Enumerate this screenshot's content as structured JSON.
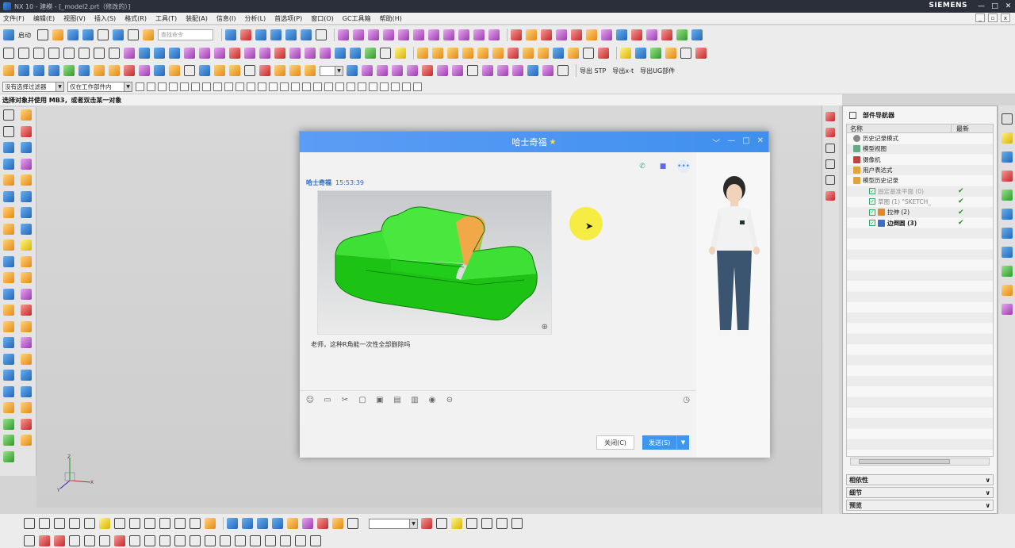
{
  "window": {
    "title": "NX 10 - 建模 - [_model2.prt（修改的）]",
    "brand": "SIEMENS",
    "controls": [
      "—",
      "□",
      "✕"
    ]
  },
  "menu": {
    "items": [
      "文件(F)",
      "编辑(E)",
      "视图(V)",
      "插入(S)",
      "格式(R)",
      "工具(T)",
      "装配(A)",
      "信息(I)",
      "分析(L)",
      "首选项(P)",
      "窗口(O)",
      "GC工具箱",
      "帮助(H)"
    ]
  },
  "toolbar": {
    "start_label": "启动",
    "search_placeholder": "查找命令",
    "export_stp": "导出 STP",
    "export_xt": "导出x-t",
    "export_ug": "导出UG部件"
  },
  "selection": {
    "filter_value": "没有选择过滤器",
    "scope_value": "仅在工作部件内"
  },
  "status_prompt": "选择对象并使用 MB3，或者双击某一对象",
  "navigator": {
    "title": "部件导航器",
    "col_name": "名称",
    "col_latest": "最新",
    "nodes": [
      {
        "label": "历史记录模式",
        "level": 0,
        "checked": false,
        "latest": false
      },
      {
        "label": "模型视图",
        "level": 0,
        "checked": false,
        "latest": false
      },
      {
        "label": "摄像机",
        "level": 0,
        "checked": false,
        "latest": false
      },
      {
        "label": "用户表达式",
        "level": 0,
        "checked": false,
        "latest": false
      },
      {
        "label": "模型历史记录",
        "level": 0,
        "checked": false,
        "latest": false
      },
      {
        "label": "固定基准平面 (0)",
        "level": 1,
        "checked": true,
        "latest": true
      },
      {
        "label": "草图 (1) \"SKETCH_",
        "level": 1,
        "checked": true,
        "latest": true
      },
      {
        "label": "拉伸 (2)",
        "level": 1,
        "checked": true,
        "latest": true
      },
      {
        "label": "边倒圆 (3)",
        "level": 1,
        "checked": true,
        "latest": true
      }
    ],
    "panels": [
      "相依性",
      "细节",
      "预览"
    ]
  },
  "chat": {
    "title": "哈士奇福",
    "sender": "哈士奇福",
    "time": "15:53:39",
    "message": "老师，这种R角能一次性全部删除吗",
    "close_button": "关闭(C)",
    "send_button": "发送(S)"
  },
  "colors": {
    "chat_header": "#4a95f2",
    "model_green": "#22d11d",
    "fillet_orange": "#f0a848",
    "highlight_yellow": "#f6ec3a"
  }
}
